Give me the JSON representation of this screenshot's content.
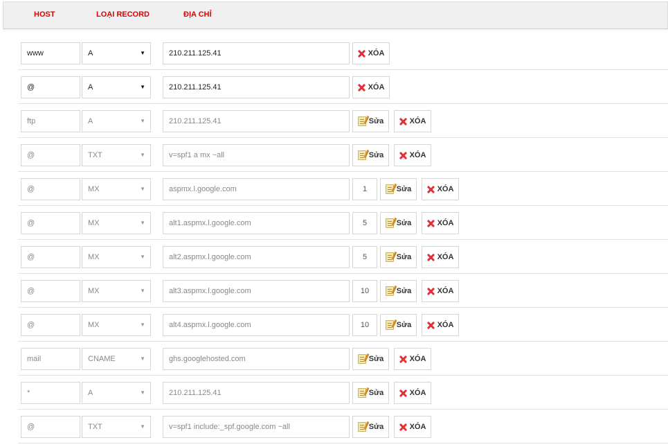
{
  "header": {
    "host": "HOST",
    "type": "LOẠI RECORD",
    "address": "ĐỊA CHỈ"
  },
  "labels": {
    "edit": "Sửa",
    "delete": "XÓA"
  },
  "colors": {
    "header_text": "#e00000",
    "delete_icon": "#e0303a"
  },
  "records": [
    {
      "host": "www",
      "type": "A",
      "address": "210.211.125.41",
      "priority": null,
      "editable": false
    },
    {
      "host": "@",
      "type": "A",
      "address": "210.211.125.41",
      "priority": null,
      "editable": false
    },
    {
      "host": "ftp",
      "type": "A",
      "address": "210.211.125.41",
      "priority": null,
      "editable": true
    },
    {
      "host": "@",
      "type": "TXT",
      "address": "v=spf1 a mx ~all",
      "priority": null,
      "editable": true
    },
    {
      "host": "@",
      "type": "MX",
      "address": "aspmx.l.google.com",
      "priority": "1",
      "editable": true
    },
    {
      "host": "@",
      "type": "MX",
      "address": "alt1.aspmx.l.google.com",
      "priority": "5",
      "editable": true
    },
    {
      "host": "@",
      "type": "MX",
      "address": "alt2.aspmx.l.google.com",
      "priority": "5",
      "editable": true
    },
    {
      "host": "@",
      "type": "MX",
      "address": "alt3.aspmx.l.google.com",
      "priority": "10",
      "editable": true
    },
    {
      "host": "@",
      "type": "MX",
      "address": "alt4.aspmx.l.google.com",
      "priority": "10",
      "editable": true
    },
    {
      "host": "mail",
      "type": "CNAME",
      "address": "ghs.googlehosted.com",
      "priority": null,
      "editable": true
    },
    {
      "host": "*",
      "type": "A",
      "address": "210.211.125.41",
      "priority": null,
      "editable": true
    },
    {
      "host": "@",
      "type": "TXT",
      "address": "v=spf1 include:_spf.google.com ~all",
      "priority": null,
      "editable": true
    }
  ]
}
